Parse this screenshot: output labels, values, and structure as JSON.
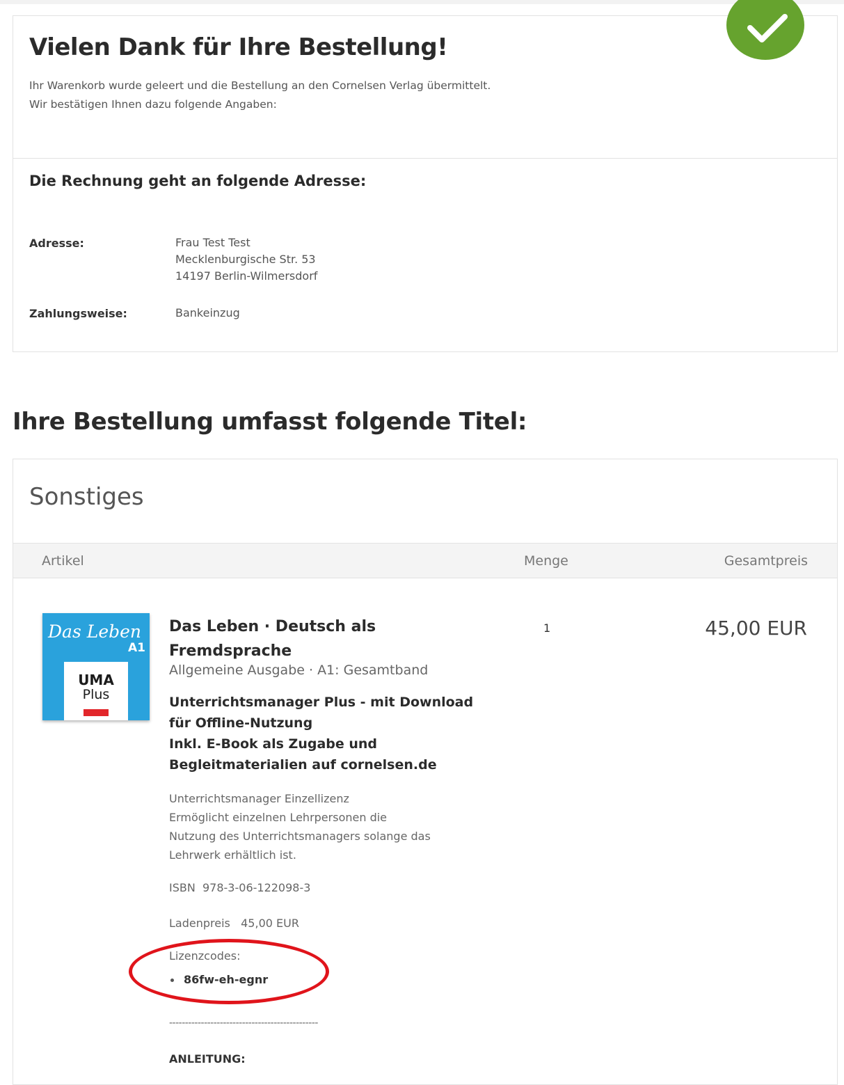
{
  "confirmation": {
    "title": "Vielen Dank für Ihre Bestellung!",
    "intro_line1": "Ihr Warenkorb wurde geleert und die Bestellung an den Cornelsen Verlag übermittelt.",
    "intro_line2": "Wir bestätigen Ihnen dazu folgende Angaben:",
    "status_icon": "check-icon",
    "status_color": "#66a32e"
  },
  "billing": {
    "title": "Die Rechnung geht an folgende Adresse:",
    "address_label": "Adresse:",
    "address_lines": [
      "Frau Test Test",
      "Mecklenburgische Str. 53",
      "14197 Berlin-Wilmersdorf"
    ],
    "payment_label": "Zahlungsweise:",
    "payment_value": "Bankeinzug"
  },
  "order": {
    "heading": "Ihre Bestellung umfasst folgende Titel:",
    "category": "Sonstiges",
    "columns": {
      "article": "Artikel",
      "quantity": "Menge",
      "total": "Gesamtpreis"
    },
    "item": {
      "cover": {
        "title": "Das Leben",
        "level": "A1",
        "line1": "UMA",
        "line2": "Plus"
      },
      "name_lines": [
        "Das Leben · Deutsch als",
        "Fremdsprache"
      ],
      "subtitle": "Allgemeine Ausgabe · A1: Gesamtband",
      "description_lines": [
        "Unterrichtsmanager Plus - mit Download",
        "für Offline-Nutzung",
        "Inkl. E-Book als Zugabe und",
        "Begleitmaterialien auf cornelsen.de"
      ],
      "text_lines": [
        "Unterrichtsmanager Einzellizenz",
        "Ermöglicht einzelnen Lehrpersonen die",
        "Nutzung des Unterrichtsmanagers solange das",
        "Lehrwerk erhältlich ist."
      ],
      "isbn": "ISBN  978-3-06-122098-3",
      "store_price": "Ladenpreis   45,00 EUR",
      "license_label": "Lizenzcodes:",
      "license_codes": [
        "86fw-eh-egnr"
      ],
      "divider": "-----------------------------------------------",
      "instructions_label": "ANLEITUNG:",
      "quantity": "1",
      "total": "45,00 EUR"
    }
  },
  "annotation_color": "#e0141b"
}
